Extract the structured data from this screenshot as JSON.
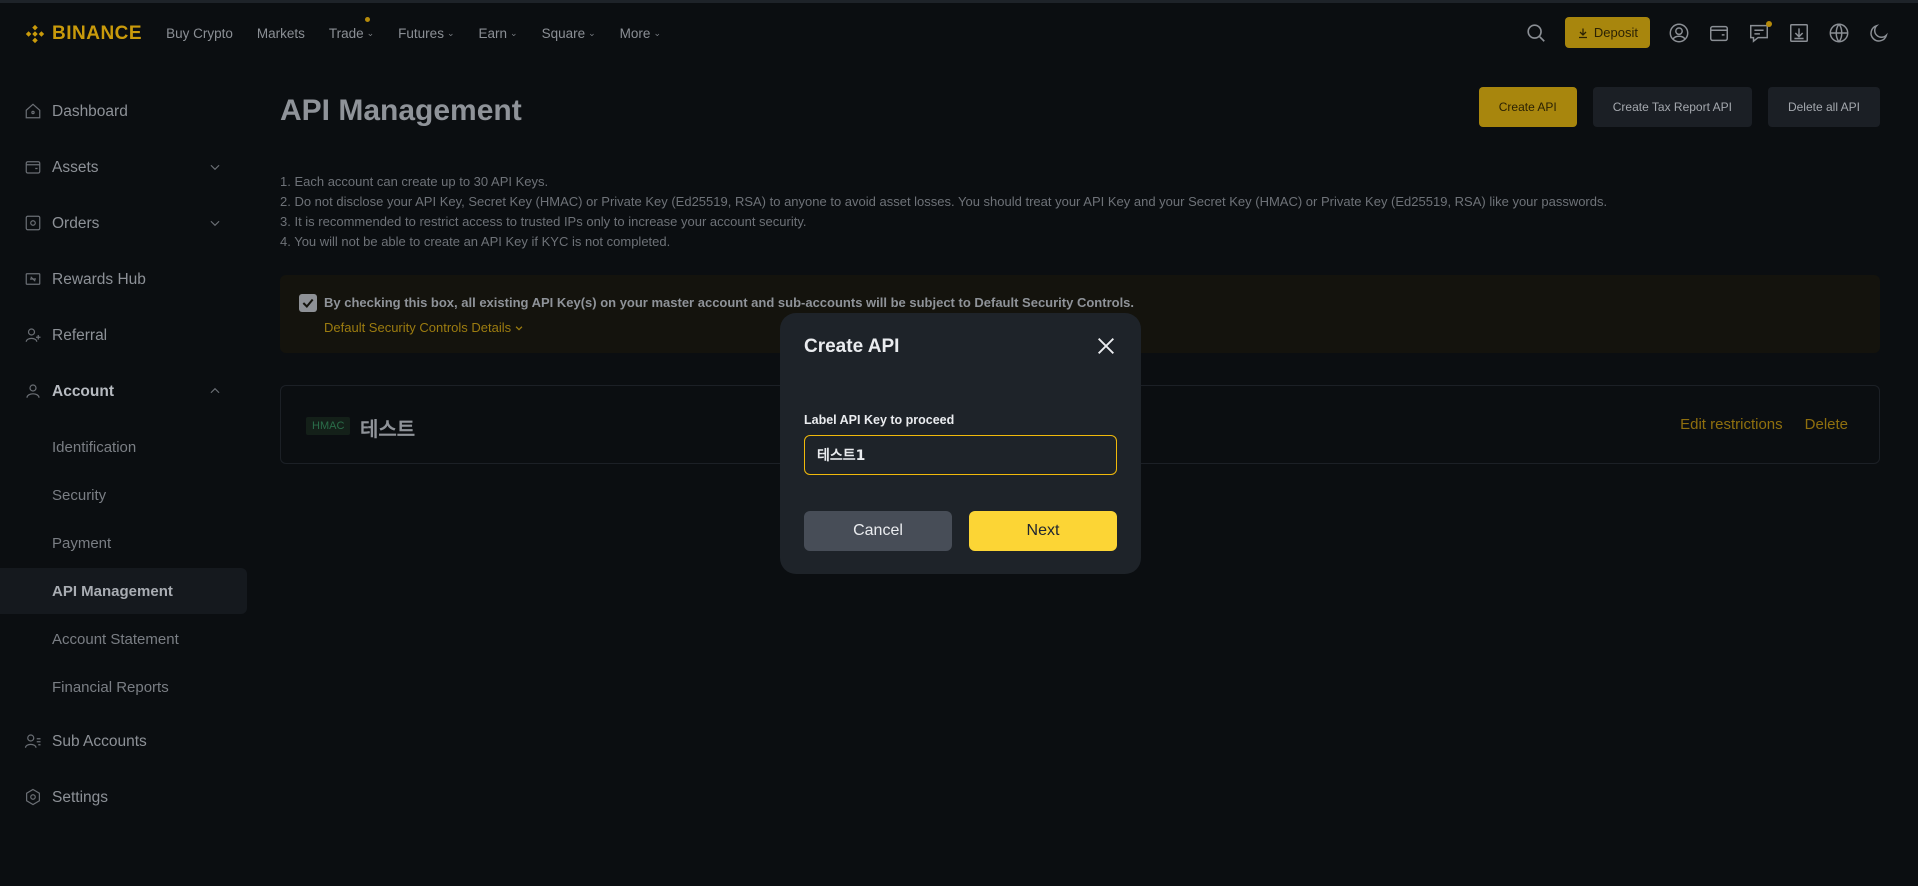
{
  "brand": {
    "name": "BINANCE",
    "color": "#F0B90B"
  },
  "nav": {
    "items": [
      {
        "label": "Buy Crypto",
        "has_menu": false,
        "dot": false
      },
      {
        "label": "Markets",
        "has_menu": false,
        "dot": false
      },
      {
        "label": "Trade",
        "has_menu": true,
        "dot": true
      },
      {
        "label": "Futures",
        "has_menu": true,
        "dot": false
      },
      {
        "label": "Earn",
        "has_menu": true,
        "dot": false
      },
      {
        "label": "Square",
        "has_menu": true,
        "dot": false
      },
      {
        "label": "More",
        "has_menu": true,
        "dot": false
      }
    ],
    "deposit_label": "Deposit",
    "icons": [
      "search-icon",
      "user-icon",
      "wallet-icon",
      "messages-icon",
      "download-icon",
      "globe-icon",
      "moon-icon"
    ]
  },
  "sidebar": {
    "items": [
      {
        "label": "Dashboard",
        "icon": "home-icon"
      },
      {
        "label": "Assets",
        "icon": "wallet-icon",
        "expandable": true
      },
      {
        "label": "Orders",
        "icon": "orders-icon",
        "expandable": true
      },
      {
        "label": "Rewards Hub",
        "icon": "ticket-icon"
      },
      {
        "label": "Referral",
        "icon": "user-plus-icon"
      },
      {
        "label": "Account",
        "icon": "user-icon",
        "expanded": true
      }
    ],
    "account_sub": [
      {
        "label": "Identification"
      },
      {
        "label": "Security"
      },
      {
        "label": "Payment"
      },
      {
        "label": "API Management",
        "active": true
      },
      {
        "label": "Account Statement"
      },
      {
        "label": "Financial Reports"
      }
    ],
    "bottom_items": [
      {
        "label": "Sub Accounts",
        "icon": "users-icon"
      },
      {
        "label": "Settings",
        "icon": "settings-icon"
      }
    ]
  },
  "main": {
    "title": "API Management",
    "buttons": {
      "create": "Create API",
      "tax": "Create Tax Report API",
      "delete_all": "Delete all API"
    },
    "notes": [
      "1. Each account can create up to 30 API Keys.",
      "2. Do not disclose your API Key, Secret Key (HMAC) or Private Key (Ed25519, RSA) to anyone to avoid asset losses. You should treat your API Key and your Secret Key (HMAC) or Private Key (Ed25519, RSA) like your passwords.",
      "3. It is recommended to restrict access to trusted IPs only to increase your account security.",
      "4. You will not be able to create an API Key if KYC is not completed."
    ],
    "banner": {
      "checked": true,
      "text": "By checking this box, all existing API Key(s) on your master account and sub-accounts will be subject to Default Security Controls.",
      "link": "Default Security Controls Details"
    },
    "key": {
      "tag": "HMAC",
      "name": "테스트",
      "edit": "Edit restrictions",
      "delete": "Delete"
    }
  },
  "modal": {
    "title": "Create API",
    "label": "Label API Key to proceed",
    "input_value": "테스트1",
    "cancel": "Cancel",
    "next": "Next"
  }
}
